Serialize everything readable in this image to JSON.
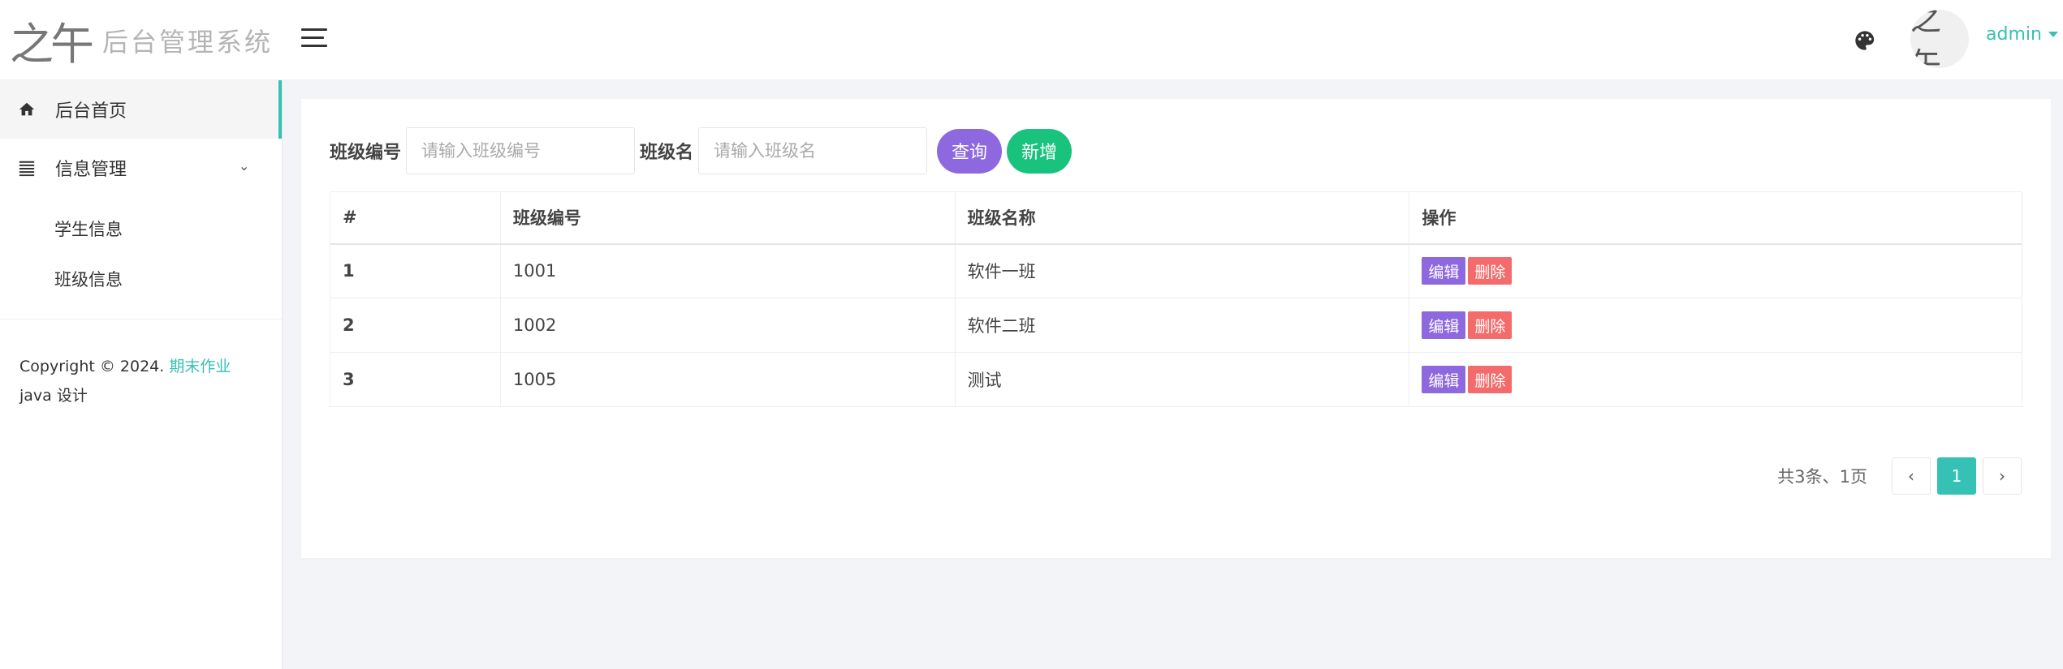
{
  "header": {
    "logo_mark": "之午",
    "logo_text": "后台管理系统",
    "avatar_mark": "之午",
    "username": "admin"
  },
  "sidebar": {
    "items": [
      {
        "label": "后台首页"
      },
      {
        "label": "信息管理"
      }
    ],
    "sub_items": [
      {
        "label": "学生信息"
      },
      {
        "label": "班级信息"
      }
    ],
    "copyright_prefix": "Copyright © 2024. ",
    "copyright_link": "期末作业",
    "copyright_suffix": " java 设计"
  },
  "search": {
    "label_no": "班级编号",
    "placeholder_no": "请输入班级编号",
    "label_name": "班级名",
    "placeholder_name": "请输入班级名",
    "query_label": "查询",
    "add_label": "新增"
  },
  "table": {
    "headers": [
      "#",
      "班级编号",
      "班级名称",
      "操作"
    ],
    "rows": [
      {
        "idx": "1",
        "no": "1001",
        "name": "软件一班"
      },
      {
        "idx": "2",
        "no": "1002",
        "name": "软件二班"
      },
      {
        "idx": "3",
        "no": "1005",
        "name": "测试"
      }
    ],
    "edit_label": "编辑",
    "delete_label": "删除"
  },
  "pagination": {
    "summary": "共3条、1页",
    "prev": "‹",
    "current": "1",
    "next": "›"
  },
  "colors": {
    "accent": "#35c2b4",
    "purple": "#8d68de",
    "green": "#19c37d",
    "red": "#f46b6b"
  }
}
